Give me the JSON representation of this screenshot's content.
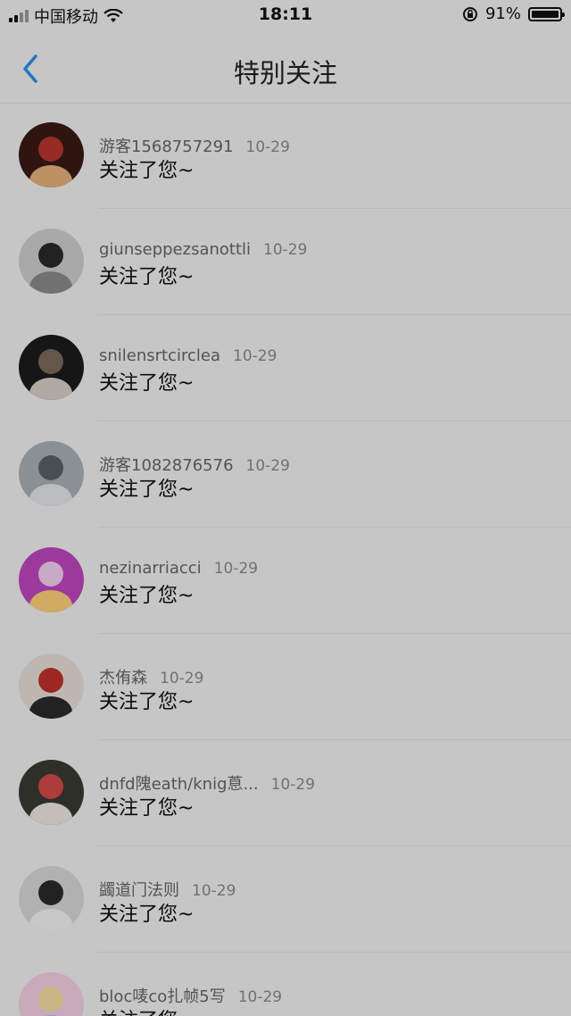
{
  "status_bar": {
    "carrier": "中国移动",
    "time": "18:11",
    "battery": "91%"
  },
  "nav": {
    "title": "特别关注",
    "back_icon": "chevron-left-icon"
  },
  "colors": {
    "accent": "#2d8ee6",
    "background": "#f2f2f2",
    "separator": "#e3e3e3"
  },
  "items": [
    {
      "name": "游客1568757291",
      "date": "10-29",
      "message": "关注了您~",
      "avatar_icon": "avatar-photo"
    },
    {
      "name": "giunseppezsanottli",
      "date": "10-29",
      "message": "关注了您~",
      "avatar_icon": "avatar-photo"
    },
    {
      "name": "snilensrtcirclea",
      "date": "10-29",
      "message": "关注了您~",
      "avatar_icon": "avatar-photo"
    },
    {
      "name": "游客1082876576",
      "date": "10-29",
      "message": "关注了您~",
      "avatar_icon": "avatar-photo"
    },
    {
      "name": "nezinarriacci",
      "date": "10-29",
      "message": "关注了您~",
      "avatar_icon": "avatar-photo"
    },
    {
      "name": "杰侑森",
      "date": "10-29",
      "message": "关注了您~",
      "avatar_icon": "avatar-photo"
    },
    {
      "name": "dnfd隗eath/knig蒠...",
      "date": "10-29",
      "message": "关注了您~",
      "avatar_icon": "avatar-photo"
    },
    {
      "name": "蠲道门法则",
      "date": "10-29",
      "message": "关注了您~",
      "avatar_icon": "avatar-photo"
    },
    {
      "name": "bloc唛co扎帧5写",
      "date": "10-29",
      "message": "关注了您",
      "avatar_icon": "avatar-photo"
    }
  ]
}
